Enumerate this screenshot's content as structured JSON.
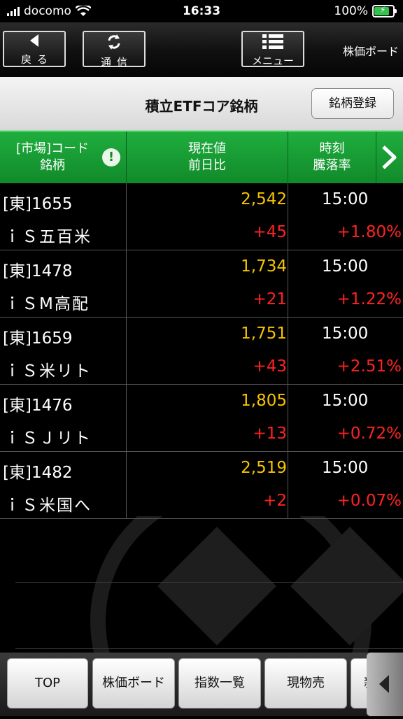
{
  "status_bar": {
    "carrier": "docomo",
    "time": "16:33",
    "battery": "100%"
  },
  "toolbar": {
    "back_label": "戻る",
    "refresh_label": "通信",
    "menu_label": "メニュー",
    "screen_title": "株価ボード"
  },
  "title_bar": {
    "list_title": "積立ETFコア銘柄",
    "register_label": "銘柄登録"
  },
  "columns": {
    "col1_line1": "[市場]コード",
    "col1_line2": "銘柄",
    "col2_line1": "現在値",
    "col2_line2": "前日比",
    "col3_line1": "時刻",
    "col3_line2": "騰落率"
  },
  "rows": [
    {
      "code": "[東]1655",
      "name": "ｉＳ五百米",
      "price": "2,542",
      "change": "+45",
      "time": "15:00",
      "pct": "+1.80%"
    },
    {
      "code": "[東]1478",
      "name": "ｉＳM高配",
      "price": "1,734",
      "change": "+21",
      "time": "15:00",
      "pct": "+1.22%"
    },
    {
      "code": "[東]1659",
      "name": "ｉＳ米リト",
      "price": "1,751",
      "change": "+43",
      "time": "15:00",
      "pct": "+2.51%"
    },
    {
      "code": "[東]1476",
      "name": "ｉＳＪリト",
      "price": "1,805",
      "change": "+13",
      "time": "15:00",
      "pct": "+0.72%"
    },
    {
      "code": "[東]1482",
      "name": "ｉＳ米国へ",
      "price": "2,519",
      "change": "+2",
      "time": "15:00",
      "pct": "+0.07%"
    }
  ],
  "bottom_bar": {
    "top_label": "TOP",
    "board_label": "株価ボード",
    "index_label": "指数一覧",
    "spot_sell_label": "現物売",
    "partial_label": "新"
  },
  "colors": {
    "price": "#f5c400",
    "change_up": "#ff2222",
    "header_green": "#1fae3e"
  }
}
